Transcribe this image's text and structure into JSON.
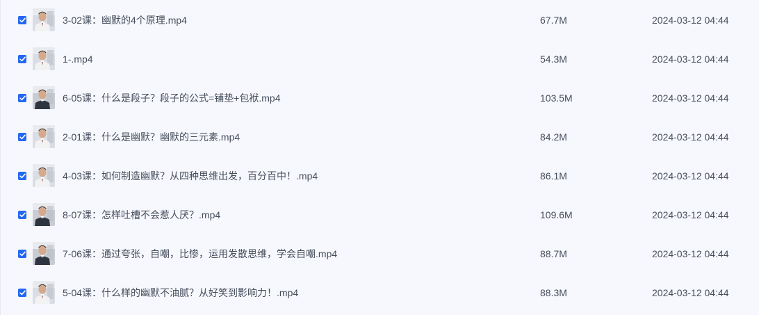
{
  "files": [
    {
      "name": "3-02课：幽默的4个原理.mp4",
      "size": "67.7M",
      "date": "2024-03-12 04:44",
      "checked": true,
      "thumb_icon": "video-thumbnail-icon"
    },
    {
      "name": "1-.mp4",
      "size": "54.3M",
      "date": "2024-03-12 04:44",
      "checked": true,
      "thumb_icon": "video-thumbnail-icon"
    },
    {
      "name": "6-05课：什么是段子？段子的公式=铺垫+包袱.mp4",
      "size": "103.5M",
      "date": "2024-03-12 04:44",
      "checked": true,
      "thumb_icon": "video-thumbnail-icon"
    },
    {
      "name": "2-01课：什么是幽默？幽默的三元素.mp4",
      "size": "84.2M",
      "date": "2024-03-12 04:44",
      "checked": true,
      "thumb_icon": "video-thumbnail-icon"
    },
    {
      "name": "4-03课：如何制造幽默？从四种思维出发，百分百中！.mp4",
      "size": "86.1M",
      "date": "2024-03-12 04:44",
      "checked": true,
      "thumb_icon": "video-thumbnail-icon"
    },
    {
      "name": "8-07课：怎样吐槽不会惹人厌？.mp4",
      "size": "109.6M",
      "date": "2024-03-12 04:44",
      "checked": true,
      "thumb_icon": "video-thumbnail-icon"
    },
    {
      "name": "7-06课：通过夸张，自嘲，比惨，运用发散思维，学会自嘲.mp4",
      "size": "88.7M",
      "date": "2024-03-12 04:44",
      "checked": true,
      "thumb_icon": "video-thumbnail-icon"
    },
    {
      "name": "5-04课：什么样的幽默不油腻？从好笑到影响力！.mp4",
      "size": "88.3M",
      "date": "2024-03-12 04:44",
      "checked": true,
      "thumb_icon": "video-thumbnail-icon"
    }
  ],
  "colors": {
    "background": "#f7f8fe",
    "checkbox": "#2468f2",
    "text": "#454d5a"
  }
}
